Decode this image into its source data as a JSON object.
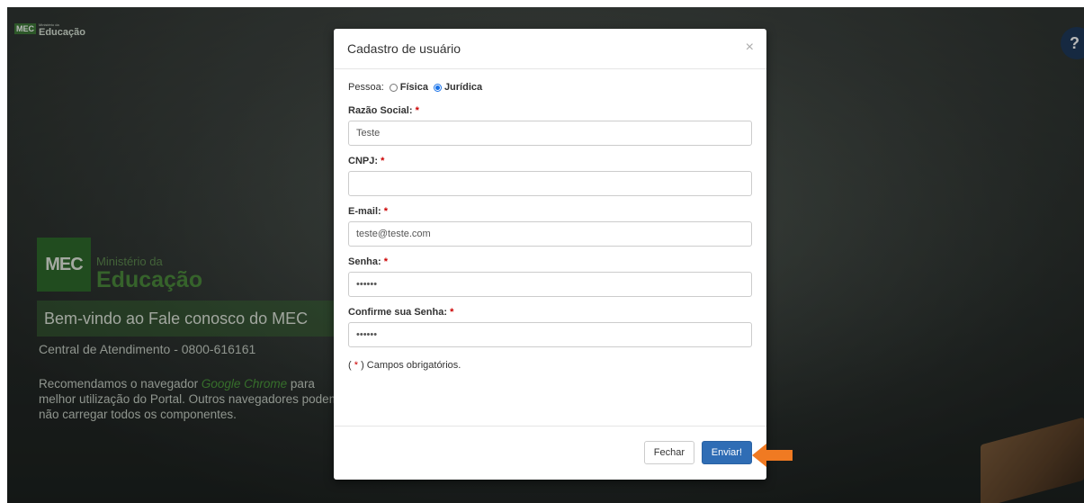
{
  "background": {
    "top_logo": {
      "mec": "MEC",
      "small": "Ministério da",
      "edu": "Educação"
    },
    "help": "?",
    "brand": {
      "mec": "MEC",
      "ministerio": "Ministério da",
      "educacao": "Educação"
    },
    "welcome": "Bem-vindo ao Fale conosco do MEC",
    "central": "Central de Atendimento - 0800-616161",
    "recommend_pre": "Recomendamos o navegador ",
    "recommend_chrome": "Google Chrome",
    "recommend_post": " para melhor utilização do Portal. Outros navegadores podem não carregar todos os componentes."
  },
  "modal": {
    "title": "Cadastro de usuário",
    "close": "×",
    "pessoa_label": "Pessoa:",
    "options": [
      {
        "label": "Física",
        "checked": false
      },
      {
        "label": "Jurídica",
        "checked": true
      }
    ],
    "fields": {
      "razao": {
        "label": "Razão Social:",
        "value": "Teste"
      },
      "cnpj": {
        "label": "CNPJ:",
        "value": ""
      },
      "email": {
        "label": "E-mail:",
        "value": "teste@teste.com"
      },
      "senha": {
        "label": "Senha:",
        "value": "••••••"
      },
      "confirme": {
        "label": "Confirme sua Senha:",
        "value": "••••••"
      }
    },
    "required_mark": "*",
    "note_pre": "( ",
    "note_star": "*",
    "note_post": " ) Campos obrigatórios.",
    "buttons": {
      "fechar": "Fechar",
      "enviar": "Enviar!"
    }
  },
  "colors": {
    "primary": "#2f6db5",
    "arrow": "#f07a22",
    "required": "#cc0000"
  }
}
